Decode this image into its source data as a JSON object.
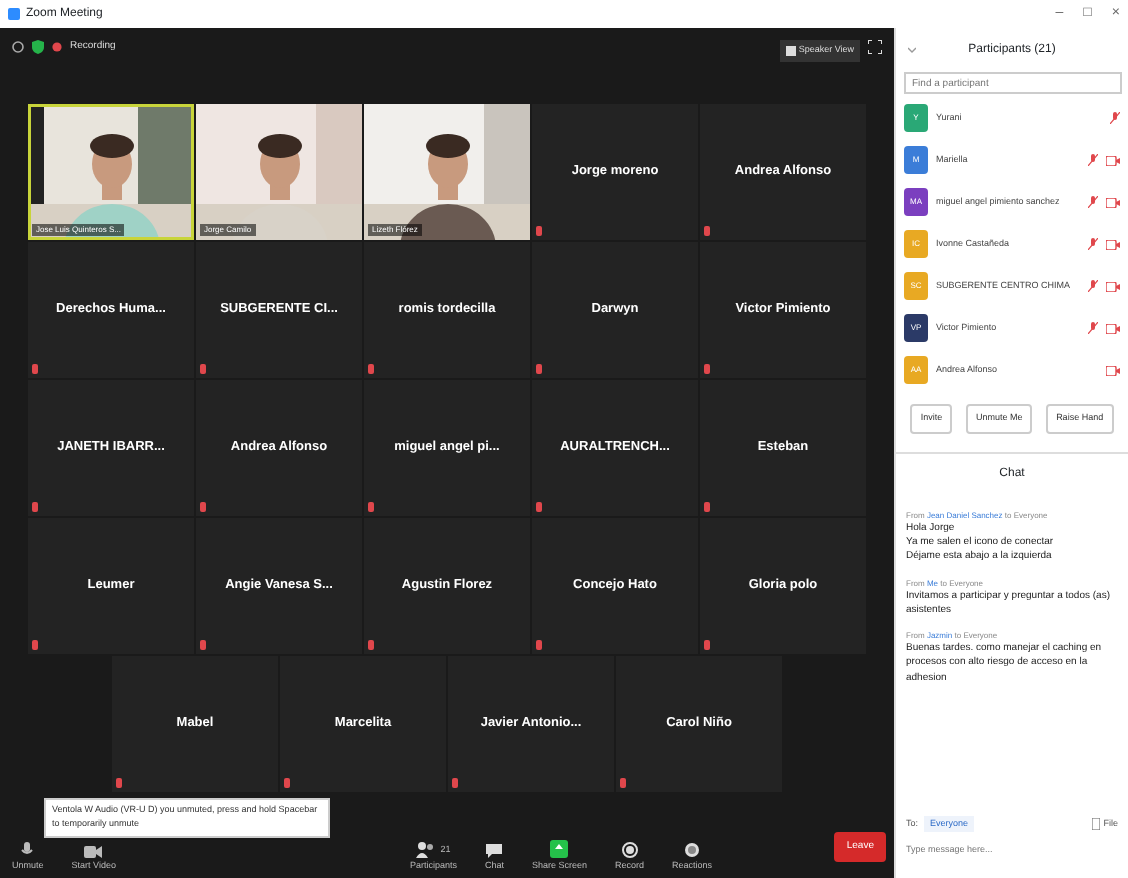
{
  "window": {
    "title": "Zoom Meeting",
    "controls": [
      "–",
      "□",
      "×"
    ]
  },
  "meeting_bar": {
    "recording_label": "Recording",
    "view_button": "Speaker View"
  },
  "tiles": [
    {
      "name": "Jose Luis Quinteros S...",
      "kind": "video",
      "muted": false,
      "selected": true
    },
    {
      "name": "Jorge Camilo",
      "kind": "video",
      "muted": false,
      "selected": false
    },
    {
      "name": "Lizeth Flórez",
      "kind": "video",
      "muted": false,
      "selected": false
    },
    {
      "name": "Jorge moreno",
      "kind": "avatar",
      "muted": true,
      "selected": false
    },
    {
      "name": "Andrea Alfonso",
      "kind": "avatar",
      "muted": true,
      "selected": false
    },
    {
      "name": "Derechos Huma...",
      "kind": "avatar",
      "muted": true,
      "selected": false
    },
    {
      "name": "SUBGERENTE CI...",
      "kind": "avatar",
      "muted": true,
      "selected": false
    },
    {
      "name": "romis tordecilla",
      "kind": "avatar",
      "muted": true,
      "selected": false
    },
    {
      "name": "Darwyn",
      "kind": "avatar",
      "muted": true,
      "selected": false
    },
    {
      "name": "Victor Pimiento",
      "kind": "avatar",
      "muted": true,
      "selected": false
    },
    {
      "name": "JANETH IBARR...",
      "kind": "avatar",
      "muted": true,
      "selected": false
    },
    {
      "name": "Andrea Alfonso",
      "kind": "avatar",
      "muted": true,
      "selected": false
    },
    {
      "name": "miguel angel pi...",
      "kind": "avatar",
      "muted": true,
      "selected": false
    },
    {
      "name": "AURALTRENCH...",
      "kind": "avatar",
      "muted": true,
      "selected": false
    },
    {
      "name": "Esteban",
      "kind": "avatar",
      "muted": true,
      "selected": false
    },
    {
      "name": "Leumer",
      "kind": "avatar",
      "muted": true,
      "selected": false
    },
    {
      "name": "Angie Vanesa S...",
      "kind": "avatar",
      "muted": true,
      "selected": false
    },
    {
      "name": "Agustin Florez",
      "kind": "avatar",
      "muted": true,
      "selected": false
    },
    {
      "name": "Concejo Hato",
      "kind": "avatar",
      "muted": true,
      "selected": false
    },
    {
      "name": "Gloria polo",
      "kind": "avatar",
      "muted": true,
      "selected": false
    },
    {
      "name": "Mabel",
      "kind": "avatar",
      "muted": true,
      "selected": false
    },
    {
      "name": "Marcelita",
      "kind": "avatar",
      "muted": true,
      "selected": false
    },
    {
      "name": "Javier Antonio...",
      "kind": "avatar",
      "muted": true,
      "selected": false
    },
    {
      "name": "Carol Niño",
      "kind": "avatar",
      "muted": true,
      "selected": false
    }
  ],
  "toolbar": {
    "notice": "Ventola W Audio (VR-U D) you unmuted, press and hold Spacebar to temporarily unmute",
    "items": [
      {
        "label": "Unmute",
        "kind": "mic"
      },
      {
        "label": "Start Video",
        "kind": "camera"
      },
      {
        "label": "Participants",
        "kind": "people",
        "count": "21"
      },
      {
        "label": "Chat",
        "kind": "chat"
      },
      {
        "label": "Share Screen",
        "kind": "share"
      },
      {
        "label": "Record",
        "kind": "record"
      },
      {
        "label": "Reactions",
        "kind": "reactions"
      }
    ],
    "leave_button": "Leave"
  },
  "participants": {
    "title": "Participants (21)",
    "search_placeholder": "Find a participant",
    "items": [
      {
        "initials": "Y",
        "name": "Yurani",
        "color": "#2aa876",
        "muted": true,
        "video_off": false
      },
      {
        "initials": "M",
        "name": "Mariella",
        "color": "#3b7dd8",
        "muted": true,
        "video_off": true
      },
      {
        "initials": "MA",
        "name": "miguel angel pimiento sanchez",
        "color": "#7b3fbf",
        "muted": true,
        "video_off": true
      },
      {
        "initials": "IC",
        "name": "Ivonne Castañeda",
        "color": "#e8a923",
        "muted": true,
        "video_off": true
      },
      {
        "initials": "SC",
        "name": "SUBGERENTE CENTRO CHIMA",
        "color": "#e8a923",
        "muted": true,
        "video_off": true
      },
      {
        "initials": "VP",
        "name": "Victor Pimiento",
        "color": "#2b3a67",
        "muted": true,
        "video_off": true
      },
      {
        "initials": "AA",
        "name": "Andrea Alfonso",
        "color": "#e8a923",
        "muted": false,
        "video_off": true
      }
    ],
    "buttons": [
      "Invite",
      "Unmute Me",
      "Raise Hand"
    ]
  },
  "chat": {
    "title": "Chat",
    "messages": [
      {
        "from": "From",
        "sender": "Jean Daniel Sanchez",
        "to": "to Everyone",
        "text": [
          "Hola Jorge",
          "Ya me salen el icono de conectar",
          "Déjame esta abajo a la izquierda"
        ]
      },
      {
        "from": "From",
        "sender": "Me",
        "to": "to Everyone",
        "text": [
          "Invitamos a participar y preguntar a todos (as) asistentes"
        ]
      },
      {
        "from": "From",
        "sender": "Jazmin",
        "to": "to Everyone",
        "text": [
          "Buenas tardes. como manejar el caching en procesos con alto riesgo de acceso en la adhesion"
        ]
      }
    ],
    "to_label": "To:",
    "recipient": "Everyone",
    "file_label": "File",
    "placeholder": "Type message here..."
  }
}
